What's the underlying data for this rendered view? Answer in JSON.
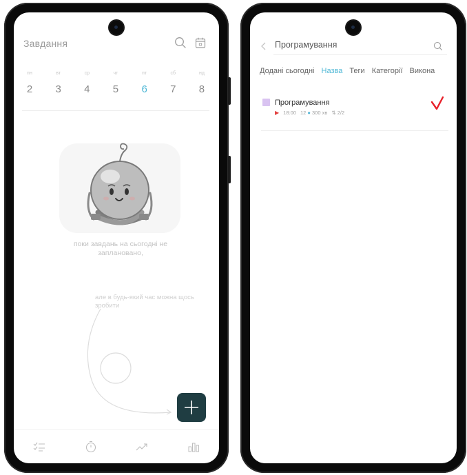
{
  "left": {
    "title": "Завдання",
    "week": [
      {
        "name": "пн",
        "num": "2"
      },
      {
        "name": "вт",
        "num": "3"
      },
      {
        "name": "ср",
        "num": "4"
      },
      {
        "name": "чт",
        "num": "5"
      },
      {
        "name": "пт",
        "num": "6"
      },
      {
        "name": "сб",
        "num": "7"
      },
      {
        "name": "нд",
        "num": "8"
      }
    ],
    "empty_message": "поки завдань на сьогодні не заплановано,",
    "hint": "але в будь-який час можна щось зробити",
    "tabs": [
      "tasks-icon",
      "timer-icon",
      "trend-icon",
      "stats-icon"
    ]
  },
  "right": {
    "title": "Програмування",
    "tabs": [
      "Додані сьогодні",
      "Назва",
      "Теги",
      "Категорії",
      "Викона"
    ],
    "active_tab_index": 1,
    "task": {
      "name": "Програмування",
      "time": "18:00",
      "duration_count": "12",
      "duration": "300 хв",
      "progress": "2/2",
      "color": "#d9c3f1"
    }
  },
  "colors": {
    "accent": "#4fb8d6",
    "fab": "#1f3d42",
    "check": "#e8202a",
    "play": "#e2403f"
  }
}
